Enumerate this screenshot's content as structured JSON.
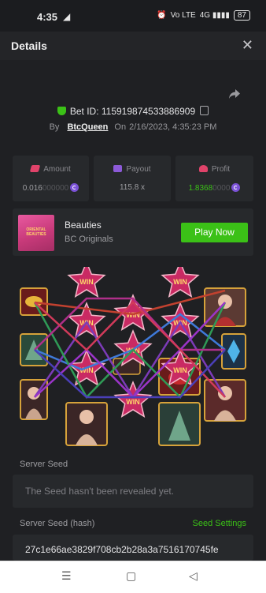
{
  "status_bar": {
    "time": "4:35",
    "telegram_glyph": "◢",
    "alarm_glyph": "⏰",
    "net_label": "Vo LTE",
    "signal_label": "4G ▮▮▮▮",
    "battery": "87"
  },
  "header": {
    "title": "Details",
    "close_glyph": "✕"
  },
  "bet": {
    "bet_id_label": "Bet ID: 115919874533886909",
    "by_label": "By",
    "username": "BtcQueen",
    "on_label": "On",
    "date": "2/16/2023, 4:35:23 PM"
  },
  "stats": {
    "amount": {
      "label": "Amount",
      "value_main": "0.016",
      "value_faded": "000000"
    },
    "payout": {
      "label": "Payout",
      "value": "115.8 x"
    },
    "profit": {
      "label": "Profit",
      "value_main": "1.8368",
      "value_faded": "0000"
    }
  },
  "game": {
    "name": "Beauties",
    "provider": "BC Originals",
    "play_label": "Play Now",
    "thumb_text": "ORIENTAL BEAUTIES"
  },
  "reels": {
    "win_label": "WIN",
    "symbols": [
      "gold-ingots",
      "woman-portrait",
      "jade-fan",
      "blue-lotus",
      "woman-portrait",
      "red-envelope",
      "woman-portrait",
      "woman-portrait",
      "woman-portrait",
      "jade-fan"
    ]
  },
  "seed": {
    "server_seed_label": "Server Seed",
    "server_seed_value": "The Seed hasn't been revealed yet.",
    "hash_label": "Server Seed (hash)",
    "seed_settings_label": "Seed Settings",
    "hash_value": "27c1e66ae3829f708cb2b28a3a7516170745fe"
  },
  "colors": {
    "accent_green": "#3bc117",
    "panel": "#27292c",
    "background": "#1f2023",
    "coin_purple": "#7b52d6"
  },
  "nav": {
    "menu_glyph": "☰",
    "home_glyph": "▢",
    "back_glyph": "◁"
  }
}
